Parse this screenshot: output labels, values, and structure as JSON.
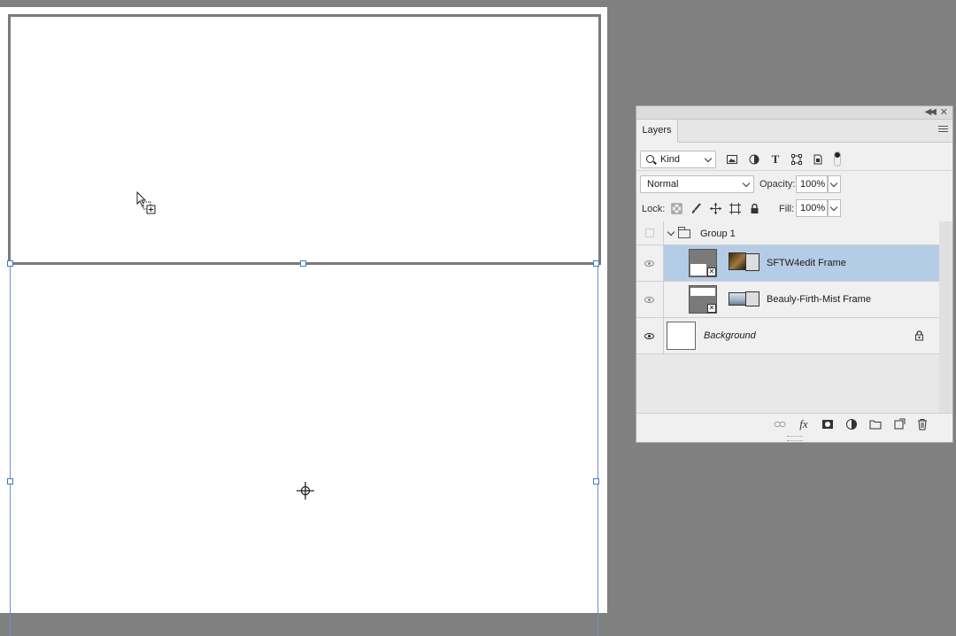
{
  "panel": {
    "tab_label": "Layers",
    "filter": {
      "kind_label": "Kind"
    },
    "blend_mode": "Normal",
    "opacity_label": "Opacity:",
    "opacity_value": "100%",
    "lock_label": "Lock:",
    "fill_label": "Fill:",
    "fill_value": "100%",
    "layers": [
      {
        "name": "Group 1",
        "type": "group",
        "visible": false,
        "selected": false
      },
      {
        "name": "SFTW4edit Frame",
        "type": "frame",
        "visible": true,
        "selected": true
      },
      {
        "name": "Beauly-Firth-Mist Frame",
        "type": "frame",
        "visible": true,
        "selected": false
      },
      {
        "name": "Background",
        "type": "background",
        "visible": true,
        "locked": true,
        "selected": false
      }
    ]
  },
  "icons": {
    "filter": [
      "image-icon",
      "adjustment-icon",
      "type-icon",
      "shape-icon",
      "smart-object-icon"
    ],
    "lock": [
      "lock-pixels-icon",
      "lock-paint-icon",
      "lock-position-icon",
      "lock-artboard-icon",
      "lock-all-icon"
    ],
    "bottom": [
      "link-icon",
      "fx-icon",
      "mask-icon",
      "adjustment-layer-icon",
      "new-group-icon",
      "new-layer-icon",
      "trash-icon"
    ]
  },
  "colors": {
    "workspace": "#808080",
    "selection": "#b5cce6",
    "bbox": "#3f79c7"
  }
}
